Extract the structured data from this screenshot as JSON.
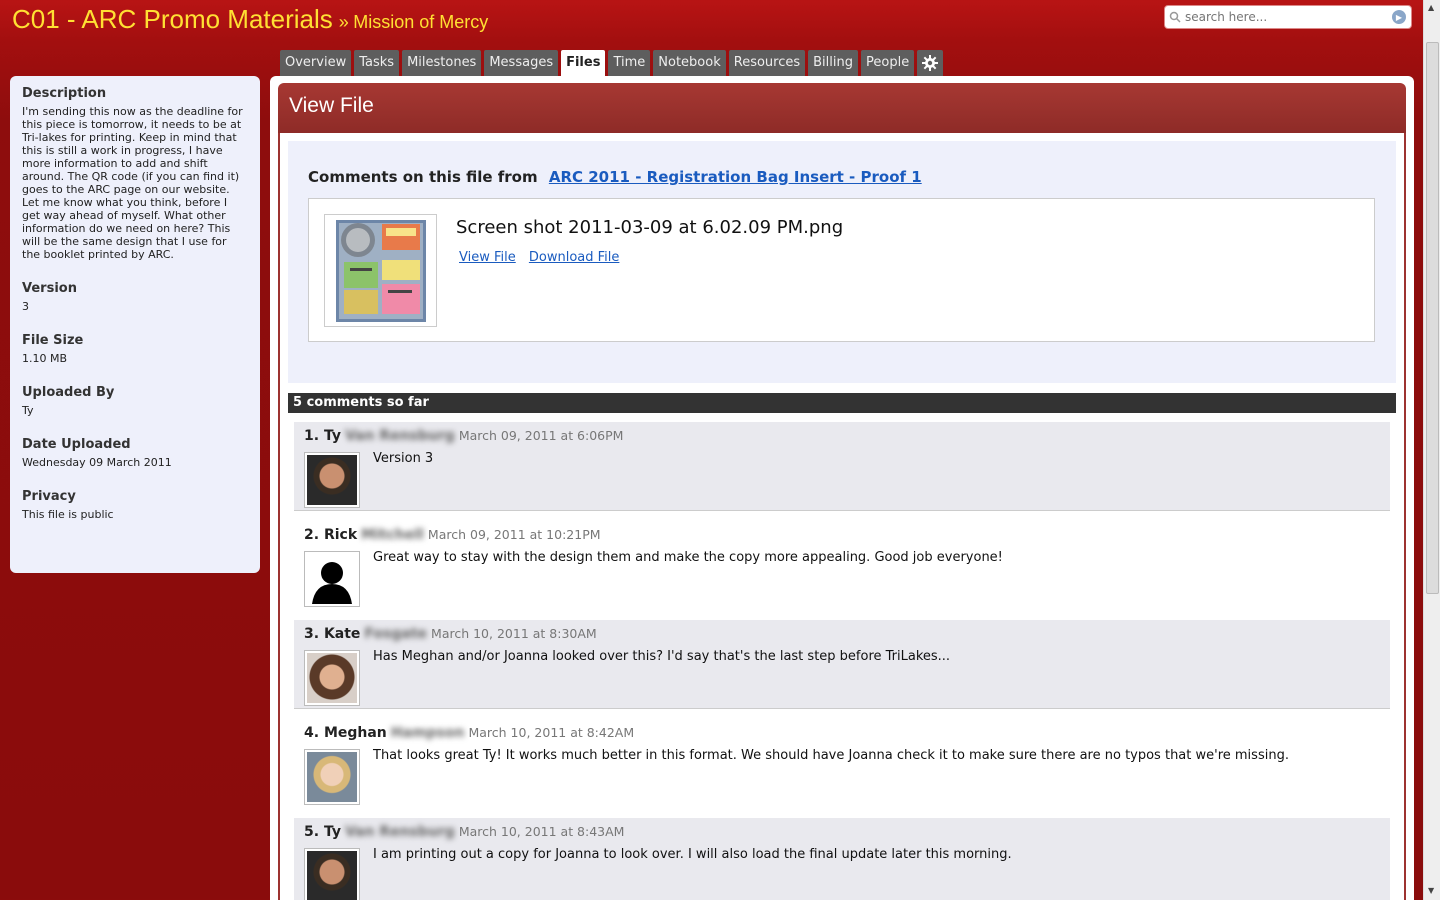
{
  "header": {
    "project": "C01 - ARC Promo Materials",
    "separator": "»",
    "client": "Mission of Mercy"
  },
  "search": {
    "placeholder": "search here..."
  },
  "tabs": [
    {
      "label": "Overview"
    },
    {
      "label": "Tasks"
    },
    {
      "label": "Milestones"
    },
    {
      "label": "Messages"
    },
    {
      "label": "Files"
    },
    {
      "label": "Time"
    },
    {
      "label": "Notebook"
    },
    {
      "label": "Resources"
    },
    {
      "label": "Billing"
    },
    {
      "label": "People"
    }
  ],
  "active_tab": "Files",
  "sidebar": {
    "description_label": "Description",
    "description": "I'm sending this now as the deadline for this piece is tomorrow, it needs to be at Tri-lakes for printing. Keep in mind that this is still a work in progress, I have more information to add and shift around. The QR code (if you can find it) goes to the ARC page on our website. Let me know what you think, before I get way ahead of myself. What other information do we need on here? This will be the same design that I use for the booklet printed by ARC.",
    "version_label": "Version",
    "version": "3",
    "filesize_label": "File Size",
    "filesize": "1.10 MB",
    "uploaded_by_label": "Uploaded By",
    "uploaded_by": "Ty",
    "date_uploaded_label": "Date Uploaded",
    "date_uploaded": "Wednesday 09 March 2011",
    "privacy_label": "Privacy",
    "privacy": "This file is public"
  },
  "panel": {
    "title": "View File",
    "comments_from_label": "Comments on this file from",
    "comments_from_link": "ARC 2011 - Registration Bag Insert - Proof 1",
    "file_name": "Screen shot 2011-03-09 at 6.02.09 PM.png",
    "view_file_label": "View File",
    "download_file_label": "Download File",
    "count_label": "5 comments so far"
  },
  "comments": [
    {
      "num": "1.",
      "first": "Ty",
      "last": "Van Rensburg",
      "date": "March 09, 2011 at 6:06PM",
      "text": "Version 3"
    },
    {
      "num": "2.",
      "first": "Rick",
      "last": "Mitchell",
      "date": "March 09, 2011 at 10:21PM",
      "text": "Great way to stay with the design them and make the copy more appealing. Good job everyone!"
    },
    {
      "num": "3.",
      "first": "Kate",
      "last": "Fosgate",
      "date": "March 10, 2011 at 8:30AM",
      "text": "Has Meghan and/or Joanna looked over this? I'd say that's the last step before TriLakes..."
    },
    {
      "num": "4.",
      "first": "Meghan",
      "last": "Hampson",
      "date": "March 10, 2011 at 8:42AM",
      "text": "That looks great Ty! It works much better in this format. We should have Joanna check it to make sure there are no typos that we're missing."
    },
    {
      "num": "5.",
      "first": "Ty",
      "last": "Van Rensburg",
      "date": "March 10, 2011 at 8:43AM",
      "text": "I am printing out a copy for Joanna to look over. I will also load the final update later this morning."
    }
  ],
  "colors": {
    "brand_red": "#a30f0f",
    "title_yellow": "#ffe033",
    "panel_header": "#9d3330",
    "link_blue": "#1a5bbf"
  }
}
